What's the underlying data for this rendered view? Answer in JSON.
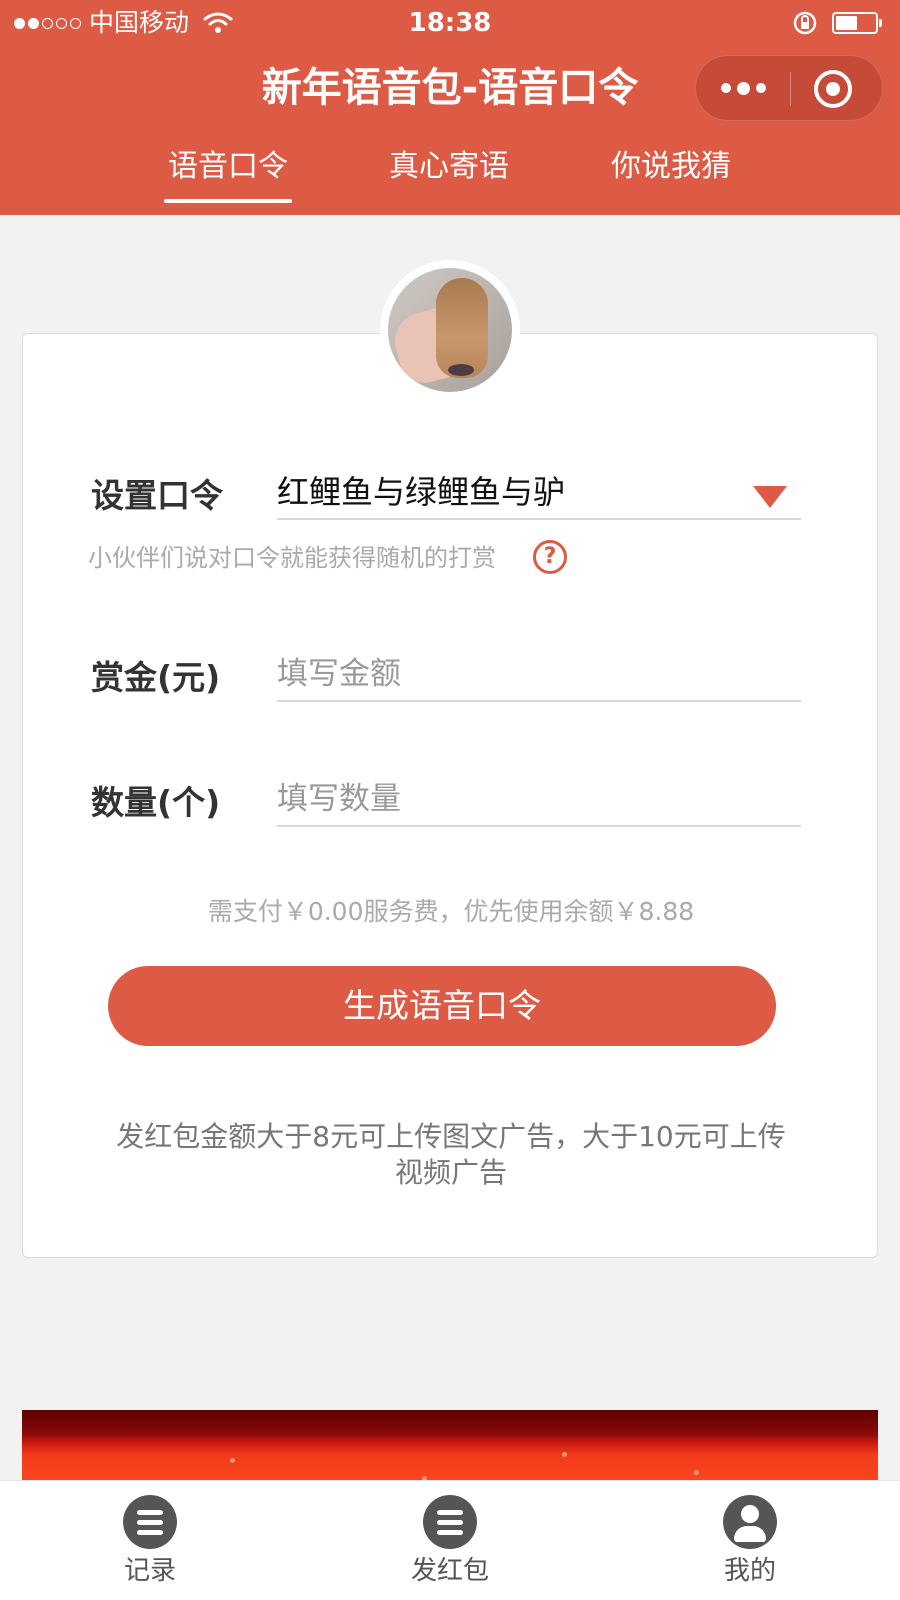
{
  "status_bar": {
    "carrier": "中国移动",
    "time": "18:38",
    "signal_level": 2,
    "signal_total": 5,
    "battery_level": 0.55
  },
  "nav": {
    "title": "新年语音包-语音口令",
    "more_icon": "more-dots-icon",
    "close_icon": "mini-program-close-icon"
  },
  "tabs": [
    {
      "label": "语音口令",
      "active": true
    },
    {
      "label": "真心寄语",
      "active": false
    },
    {
      "label": "你说我猜",
      "active": false
    }
  ],
  "form": {
    "command": {
      "label": "设置口令",
      "value": "红鲤鱼与绿鲤鱼与驴",
      "icon": "dropdown-triangle-icon"
    },
    "hint": "小伙伴们说对口令就能获得随机的打赏",
    "help_icon_glyph": "?",
    "reward": {
      "label": "赏金(元)",
      "placeholder": "填写金额"
    },
    "quantity": {
      "label": "数量(个)",
      "placeholder": "填写数量"
    },
    "fee_text": "需支付￥0.00服务费，优先使用余额￥8.88",
    "submit_label": "生成语音口令",
    "ad_note": "发红包金额大于8元可上传图文广告，大于10元可上传视频广告"
  },
  "tabbar": [
    {
      "label": "记录",
      "icon": "list-icon"
    },
    {
      "label": "发红包",
      "icon": "list-icon"
    },
    {
      "label": "我的",
      "icon": "user-icon"
    }
  ],
  "colors": {
    "brand": "#dd5a45",
    "background": "#f2f2f2"
  }
}
